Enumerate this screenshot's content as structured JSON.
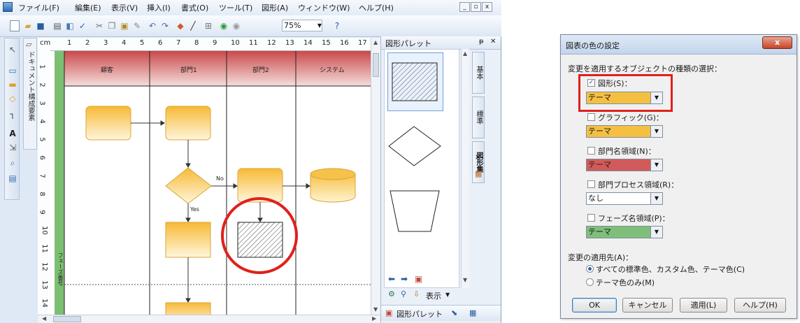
{
  "app": {
    "menus": [
      "ファイル(F)",
      "編集(E)",
      "表示(V)",
      "挿入(I)",
      "書式(O)",
      "ツール(T)",
      "図形(A)",
      "ウィンドウ(W)",
      "ヘルプ(H)"
    ],
    "window_buttons": [
      "_",
      "▫",
      "x"
    ],
    "zoom": "75%",
    "ruler_unit": "cm",
    "ruler_top": [
      "1",
      "2",
      "3",
      "4",
      "5",
      "6",
      "7",
      "8",
      "9",
      "10",
      "11",
      "12",
      "13",
      "14",
      "15",
      "16",
      "17"
    ],
    "ruler_left": [
      "1",
      "2",
      "3",
      "4",
      "5",
      "6",
      "7",
      "8",
      "9",
      "10",
      "11",
      "12",
      "13",
      "14"
    ],
    "doc_tab_label": "ドキュメント構成要素",
    "lanes": [
      "顧客",
      "部門1",
      "部門2",
      "システム"
    ],
    "phase_label": "フェーズ番号",
    "no_label": "No",
    "yes_label": "Yes",
    "palette": {
      "title": "図形パレット",
      "pin": "ᵽ",
      "close": "✕",
      "tabs": [
        "基本",
        "標準",
        "図形集"
      ],
      "tab_close": "✕",
      "display_label": "表示",
      "bottom_tab": "図形パレット"
    }
  },
  "dialog": {
    "title": "図表の色の設定",
    "close": "x",
    "section_label": "変更を適用するオブジェクトの種類の選択：",
    "items": [
      {
        "label": "図形(S)：",
        "checked": true,
        "value": "テーマ",
        "color": "#f5c042"
      },
      {
        "label": "グラフィック(G)：",
        "checked": false,
        "value": "テーマ",
        "color": "#f5c042"
      },
      {
        "label": "部門名領域(N)：",
        "checked": false,
        "value": "テーマ",
        "color": "#d25a5a"
      },
      {
        "label": "部門プロセス領域(R)：",
        "checked": false,
        "value": "なし",
        "color": "#ffffff"
      },
      {
        "label": "フェーズ名領域(P)：",
        "checked": false,
        "value": "テーマ",
        "color": "#7fbf7a"
      }
    ],
    "apply_to_label": "変更の適用先(A)：",
    "radios": [
      {
        "label": "すべての標準色、カスタム色、テーマ色(C)",
        "selected": true
      },
      {
        "label": "テーマ色のみ(M)",
        "selected": false
      }
    ],
    "buttons": [
      "OK",
      "キャンセル",
      "適用(L)",
      "ヘルプ(H)"
    ]
  },
  "colors": {
    "shape_fill": "#f8c949",
    "lane_header": "#d06a6a",
    "phase_bar": "#6fb26a",
    "highlight": "#e0201c"
  }
}
